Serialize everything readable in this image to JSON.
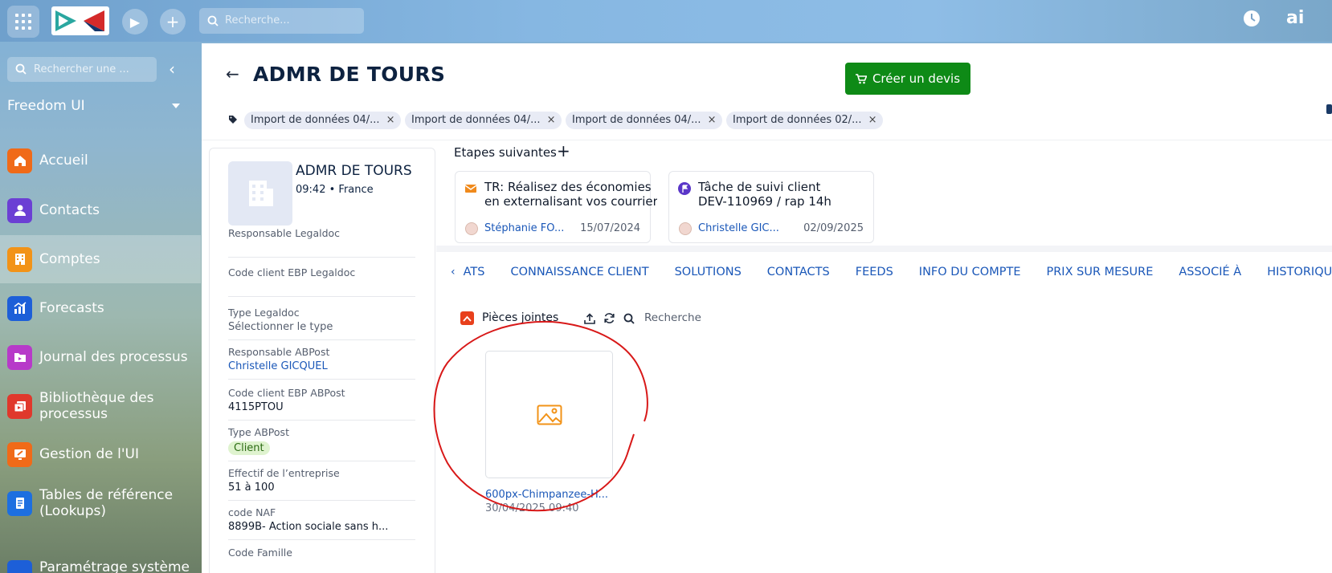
{
  "topbar": {
    "search_placeholder": "Recherche...",
    "icons": [
      "apps-grid-icon",
      "play-icon",
      "plus-icon",
      "search-icon",
      "clock-icon",
      "ai-icon"
    ],
    "ai_label": "ai"
  },
  "sidebar": {
    "search_placeholder": "Rechercher une ...",
    "workspace": "Freedom UI",
    "items": [
      {
        "label": "Accueil",
        "icon": "home-icon",
        "color": "#f06a18"
      },
      {
        "label": "Contacts",
        "icon": "person-icon",
        "color": "#6b3fd4"
      },
      {
        "label": "Comptes",
        "icon": "building-icon",
        "color": "#f29318"
      },
      {
        "label": "Forecasts",
        "icon": "chart-icon",
        "color": "#1d5fd8"
      },
      {
        "label": "Journal des processus",
        "icon": "process-log-icon",
        "color": "#b73ac9"
      },
      {
        "label": "Bibliothèque des processus",
        "icon": "process-library-icon",
        "color": "#e0382c"
      },
      {
        "label": "Gestion de l'UI",
        "icon": "ui-management-icon",
        "color": "#f06a18"
      },
      {
        "label": "Tables de référence (Lookups)",
        "icon": "lookup-icon",
        "color": "#1d6fe0"
      },
      {
        "label": "Paramétrage système",
        "icon": "settings-icon",
        "color": "#1d5fd8"
      }
    ]
  },
  "header": {
    "title": "ADMR DE TOURS",
    "create_quote_label": "Créer un devis",
    "tags": [
      "Import de données 04/...",
      "Import de données 04/...",
      "Import de données 04/...",
      "Import de données 02/..."
    ]
  },
  "account": {
    "name": "ADMR DE TOURS",
    "time": "09:42",
    "country": "France",
    "fields": [
      {
        "label": "Responsable Legaldoc",
        "value": ""
      },
      {
        "label": "Code client EBP Legaldoc",
        "value": ""
      },
      {
        "label": "Type Legaldoc",
        "value": "Sélectionner le type"
      },
      {
        "label": "Responsable ABPost",
        "value": "Christelle GICQUEL"
      },
      {
        "label": "Code client EBP ABPost",
        "value": "4115PTOU"
      },
      {
        "label": "Type ABPost",
        "value": "Client"
      },
      {
        "label": "Effectif de l’entreprise",
        "value": "51 à 100"
      },
      {
        "label": "code NAF",
        "value": "8899B- Action sociale sans h..."
      },
      {
        "label": "Code Famille",
        "value": ""
      }
    ]
  },
  "steps": {
    "title": "Etapes suivantes",
    "items": [
      {
        "line1": "TR: Réalisez des économies",
        "line2": "en externalisant vos courrier...",
        "user": "Stéphanie FO...",
        "date": "15/07/2024",
        "icon": "email-icon"
      },
      {
        "line1": "Tâche de suivi client",
        "line2": "DEV-110969 / rap 14h",
        "user": "Christelle GIC...",
        "date": "02/09/2025",
        "icon": "task-flag-icon"
      }
    ]
  },
  "tabs": [
    "ATS",
    "CONNAISSANCE CLIENT",
    "SOLUTIONS",
    "CONTACTS",
    "FEEDS",
    "INFO DU COMPTE",
    "PRIX SUR MESURE",
    "ASSOCIÉ À",
    "HISTORIQUE"
  ],
  "attachments": {
    "title": "Pièces jointes",
    "search_label": "Recherche",
    "files": [
      {
        "name": "600px-Chimpanzee-H...",
        "date": "30/04/2025 09:40"
      }
    ]
  },
  "colors": {
    "accent": "#1a57b8",
    "create_button": "#0e8a16",
    "annotation": "#d81818"
  }
}
